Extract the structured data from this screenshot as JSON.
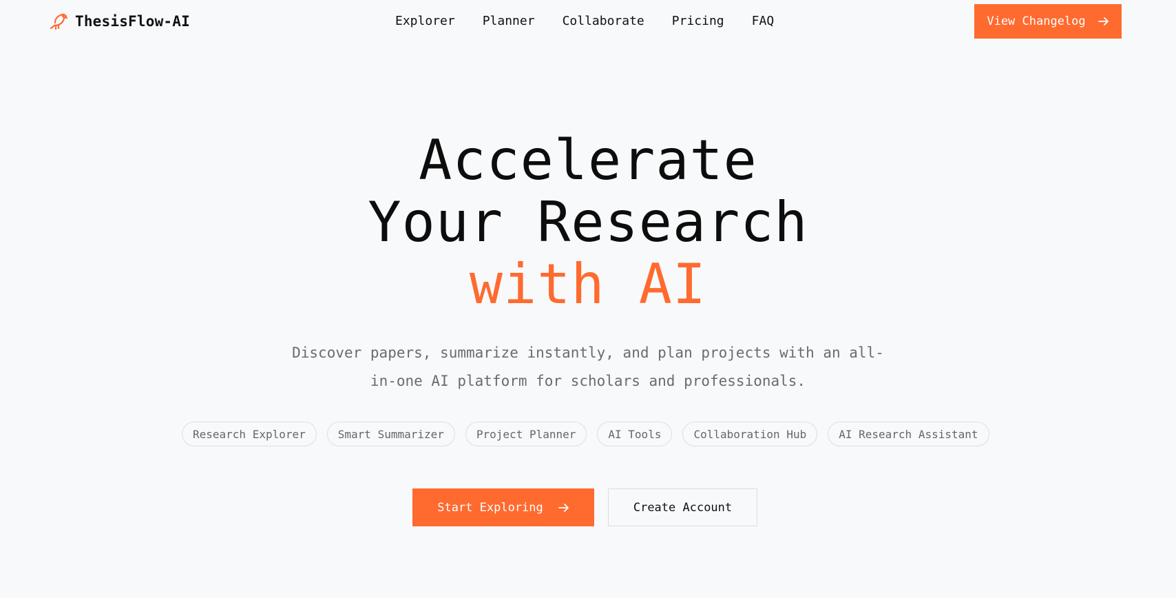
{
  "brand": {
    "name": "ThesisFlow-AI",
    "logo_icon": "bird-icon",
    "accent_color": "#ff6a2f"
  },
  "nav": {
    "links": [
      {
        "label": "Explorer"
      },
      {
        "label": "Planner"
      },
      {
        "label": "Collaborate"
      },
      {
        "label": "Pricing"
      },
      {
        "label": "FAQ"
      }
    ],
    "changelog_button": {
      "label": "View Changelog",
      "icon": "arrow-right-icon"
    }
  },
  "hero": {
    "title_line_1": "Accelerate",
    "title_line_2": "Your Research",
    "title_line_3": "with AI",
    "subtitle": "Discover papers, summarize instantly, and plan projects with an all-in-one AI platform for scholars and professionals."
  },
  "chips": [
    {
      "label": "Research Explorer"
    },
    {
      "label": "Smart Summarizer"
    },
    {
      "label": "Project Planner"
    },
    {
      "label": "AI Tools"
    },
    {
      "label": "Collaboration Hub"
    },
    {
      "label": "AI Research Assistant"
    }
  ],
  "cta": {
    "primary_label": "Start Exploring",
    "primary_icon": "arrow-right-icon",
    "secondary_label": "Create Account"
  }
}
